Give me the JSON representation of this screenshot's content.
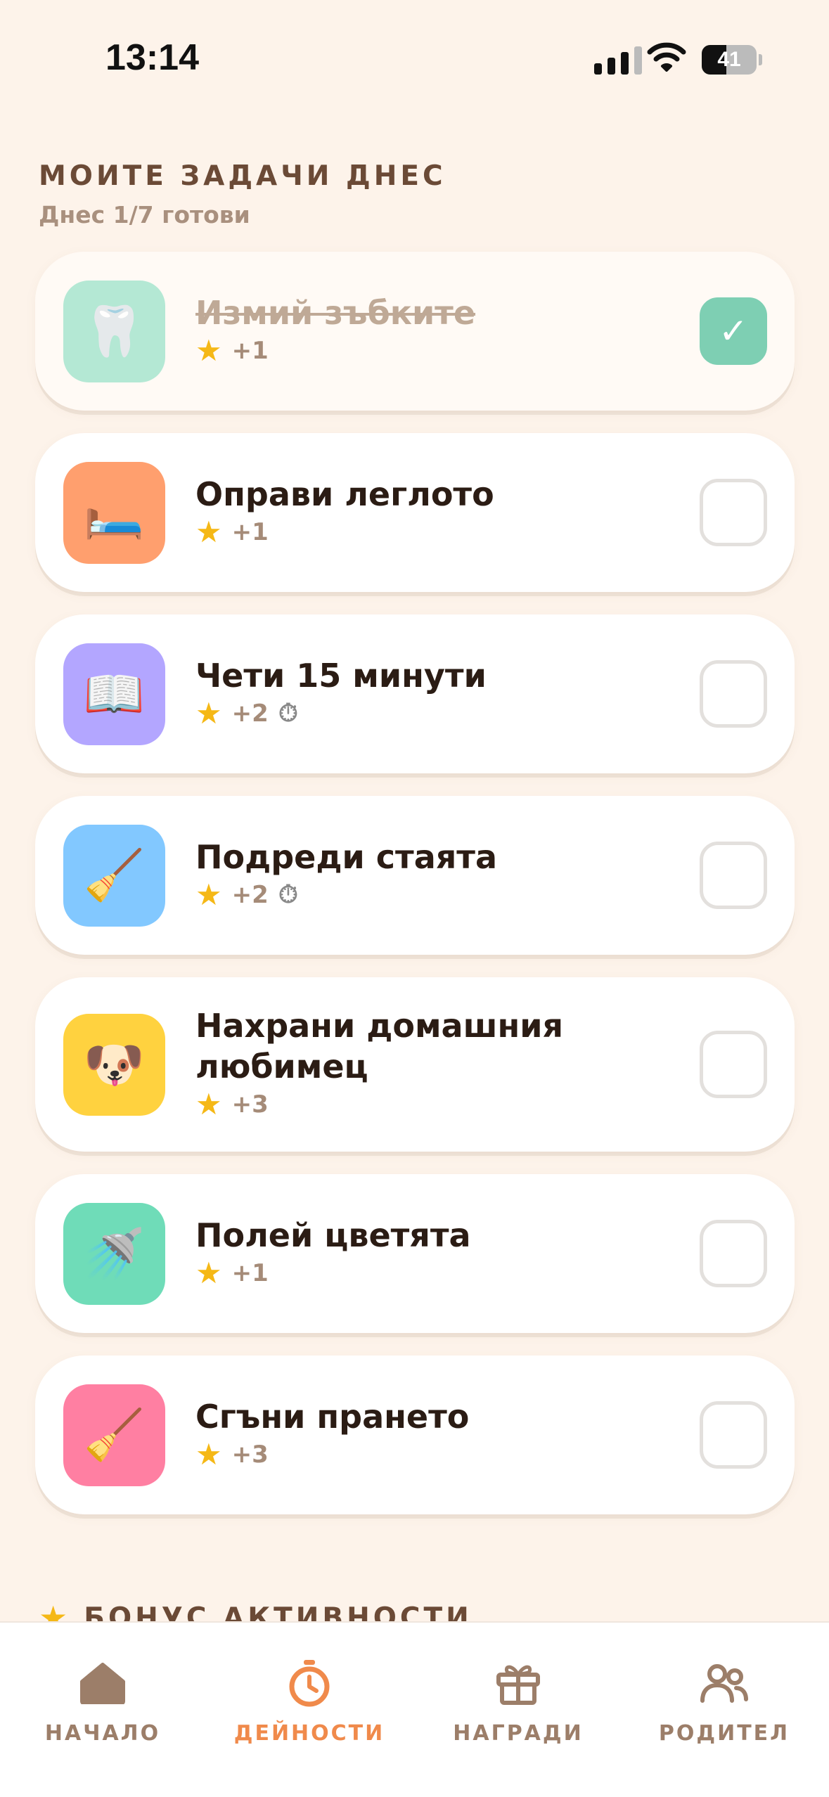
{
  "status_bar": {
    "time": "13:14",
    "battery": "41",
    "battery_level_percent": 41
  },
  "header": {
    "title": "МОИТЕ ЗАДАЧИ ДНЕС",
    "subtitle": "Днес 1/7 готови"
  },
  "tasks": [
    {
      "title": "Измий зъбките",
      "stars": "+1",
      "timer": false,
      "done": true,
      "icon": "tooth-icon",
      "emoji": "🦷",
      "color": "#a8e6cf"
    },
    {
      "title": "Оправи леглото",
      "stars": "+1",
      "timer": false,
      "done": false,
      "icon": "bed-icon",
      "emoji": "🛏️",
      "color": "#ff9f6e"
    },
    {
      "title": "Чети 15 минути",
      "stars": "+2",
      "timer": true,
      "done": false,
      "icon": "book-icon",
      "emoji": "📖",
      "color": "#b3a6ff"
    },
    {
      "title": "Подреди стаята",
      "stars": "+2",
      "timer": true,
      "done": false,
      "icon": "broom-icon",
      "emoji": "🧹",
      "color": "#82c8ff"
    },
    {
      "title": "Нахрани домашния любимец",
      "stars": "+3",
      "timer": false,
      "done": false,
      "icon": "dog-icon",
      "emoji": "🐶",
      "color": "#ffd23f"
    },
    {
      "title": "Полей цветята",
      "stars": "+1",
      "timer": false,
      "done": false,
      "icon": "shower-icon",
      "emoji": "🚿",
      "color": "#6fdcb8"
    },
    {
      "title": "Сгъни прането",
      "stars": "+3",
      "timer": false,
      "done": false,
      "icon": "broom-icon",
      "emoji": "🧹",
      "color": "#ff7fa2"
    }
  ],
  "bonus": {
    "title": "БОНУС АКТИВНОСТИ"
  },
  "tabs": [
    {
      "label": "НАЧАЛО",
      "icon": "home-icon",
      "active": false
    },
    {
      "label": "ДЕЙНОСТИ",
      "icon": "timer-icon",
      "active": true
    },
    {
      "label": "НАГРАДИ",
      "icon": "gift-icon",
      "active": false
    },
    {
      "label": "РОДИТЕЛ",
      "icon": "parents-icon",
      "active": false
    }
  ],
  "colors": {
    "accent": "#f08a4b",
    "done_check": "#7ecfb3",
    "background": "#fdf3ea",
    "heading": "#6b4a36",
    "tab_inactive": "#9c7e69"
  }
}
